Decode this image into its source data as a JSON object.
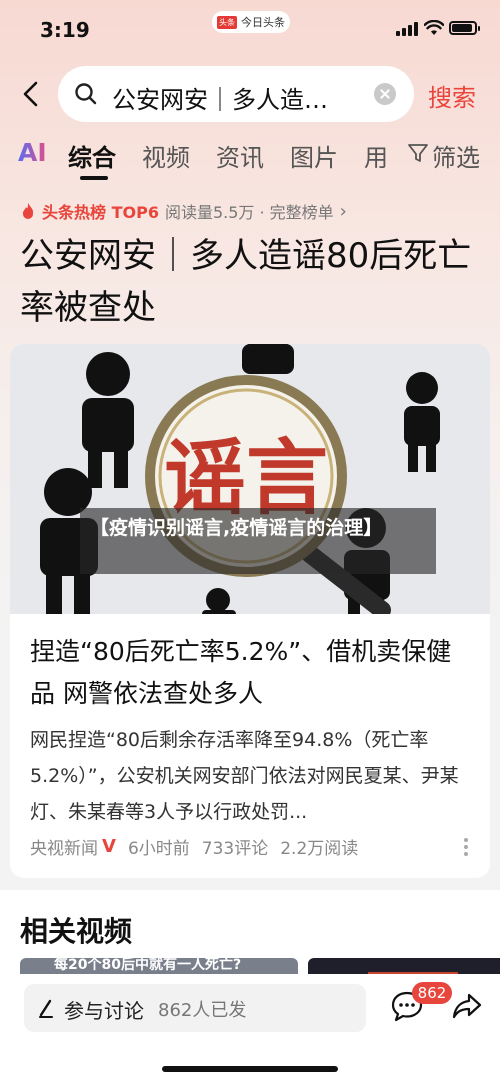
{
  "status_bar": {
    "time": "3:19",
    "pill_logo": "头条",
    "pill_text": "今日头条"
  },
  "search": {
    "query": "公安网安｜多人造…",
    "button": "搜索"
  },
  "tabs": [
    {
      "label": "AI"
    },
    {
      "label": "综合",
      "active": true
    },
    {
      "label": "视频"
    },
    {
      "label": "资讯"
    },
    {
      "label": "图片"
    },
    {
      "label": "用"
    },
    {
      "label": "筛选"
    }
  ],
  "hot": {
    "label": "头条热榜 TOP6",
    "meta": "阅读量5.5万 · 完整榜单"
  },
  "headline": "公安网安｜多人造谣80后死亡率被查处",
  "card": {
    "image_big_text": "谣言",
    "overlay_caption": "【疫情识别谣言,疫情谣言的治理】",
    "title": "捏造“80后死亡率5.2%”、借机卖保健品 网警依法查处多人",
    "summary": "网民捏造“80后剩余存活率降至94.8%（死亡率5.2%）”，公安机关网安部门依法对网民夏某、尹某灯、朱某春等3人予以行政处罚...",
    "source": "央视新闻",
    "source_badge": "V",
    "time": "6小时前",
    "comments": "733评论",
    "reads": "2.2万阅读"
  },
  "related": {
    "title": "相关视频",
    "thumb1_text": "每20个80后中就有一人死亡?"
  },
  "bottom": {
    "discuss_label": "参与讨论",
    "discuss_count": "862人已发",
    "comment_badge": "862"
  },
  "colors": {
    "accent": "#e8453c",
    "background_top": "#f7d9d2"
  }
}
